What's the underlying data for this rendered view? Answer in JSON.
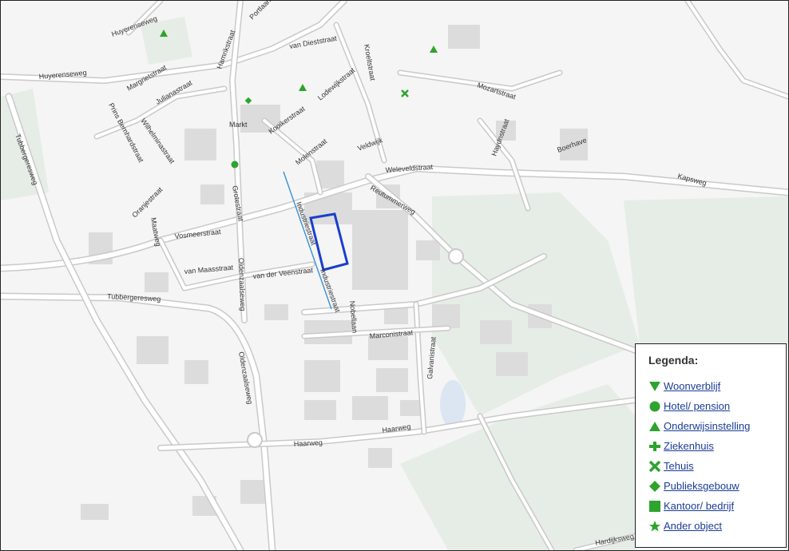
{
  "map": {
    "streets": {
      "huyerenseweg_top": "Huyerenseweg",
      "huyerenseweg_left": "Huyerenseweg",
      "tubbergeresweg_left": "Tubbergeresweg",
      "tubbergeresweg_bottom": "Tubbergeresweg",
      "prins_bernhardstraat": "Prins Bernhardstraat",
      "margrietstraat": "Margrietstraat",
      "julianastraat": "Julianastraat",
      "wilhelminastraat": "Wilhelminastraat",
      "hamrikstraat": "Hamrikstraat",
      "portlaan": "Portlaan",
      "van_dieststraat": "van Dieststraat",
      "lodewijkstraat": "Lodewijkstraat",
      "kroeltstraat": "Kroeltstraat",
      "mozartstraat": "Mozartstraat",
      "haydnstraat": "Haydnstraat",
      "boerhave": "Boerhave",
      "markt": "Markt",
      "kooikerstraat": "Kooikerstraat",
      "molenstraat": "Molenstraat",
      "veldwijk": "Veldwijk",
      "weleveldstraat": "Weleveldstraat",
      "kapsweg": "Kapsweg",
      "reutummerweg": "Reutummerweg",
      "oranjestraat": "Oranjestraat",
      "grotestraat": "Grotestraat",
      "industriestraat_top": "Industriestraat",
      "industriestraat_bottom": "Industriestraat",
      "maatweg": "Maatweg",
      "vosmeerstraat": "Vosmeerstraat",
      "van_maasstraat": "van Maasstraat",
      "oldenzaalseweg_top": "Oldenzaalseweg",
      "oldenzaalseweg_bottom": "Oldenzaalseweg",
      "van_der_veenstraat": "van der Veenstraat",
      "nobellaan": "Nobellaan",
      "marconistraat": "Marconistraat",
      "galvanistraat": "Galvanistraat",
      "haarweg_left": "Haarweg",
      "haarweg_right": "Haarweg",
      "hardijksweg": "Hardijksweg"
    }
  },
  "legend": {
    "title": "Legenda:",
    "symbol_color": "#2ea32e",
    "items": [
      {
        "label": "Woonverblijf",
        "icon": "triangle-down-icon"
      },
      {
        "label": "Hotel/ pension",
        "icon": "circle-icon"
      },
      {
        "label": "Onderwijsinstelling",
        "icon": "triangle-up-icon"
      },
      {
        "label": "Ziekenhuis",
        "icon": "plus-icon"
      },
      {
        "label": "Tehuis",
        "icon": "cross-icon"
      },
      {
        "label": "Publieksgebouw",
        "icon": "diamond-icon"
      },
      {
        "label": "Kantoor/ bedrijf",
        "icon": "square-icon"
      },
      {
        "label": "Ander object",
        "icon": "star-icon"
      }
    ]
  },
  "plan_area_color": "#1a3fcc",
  "industrial_line_color": "#3a8fd8"
}
